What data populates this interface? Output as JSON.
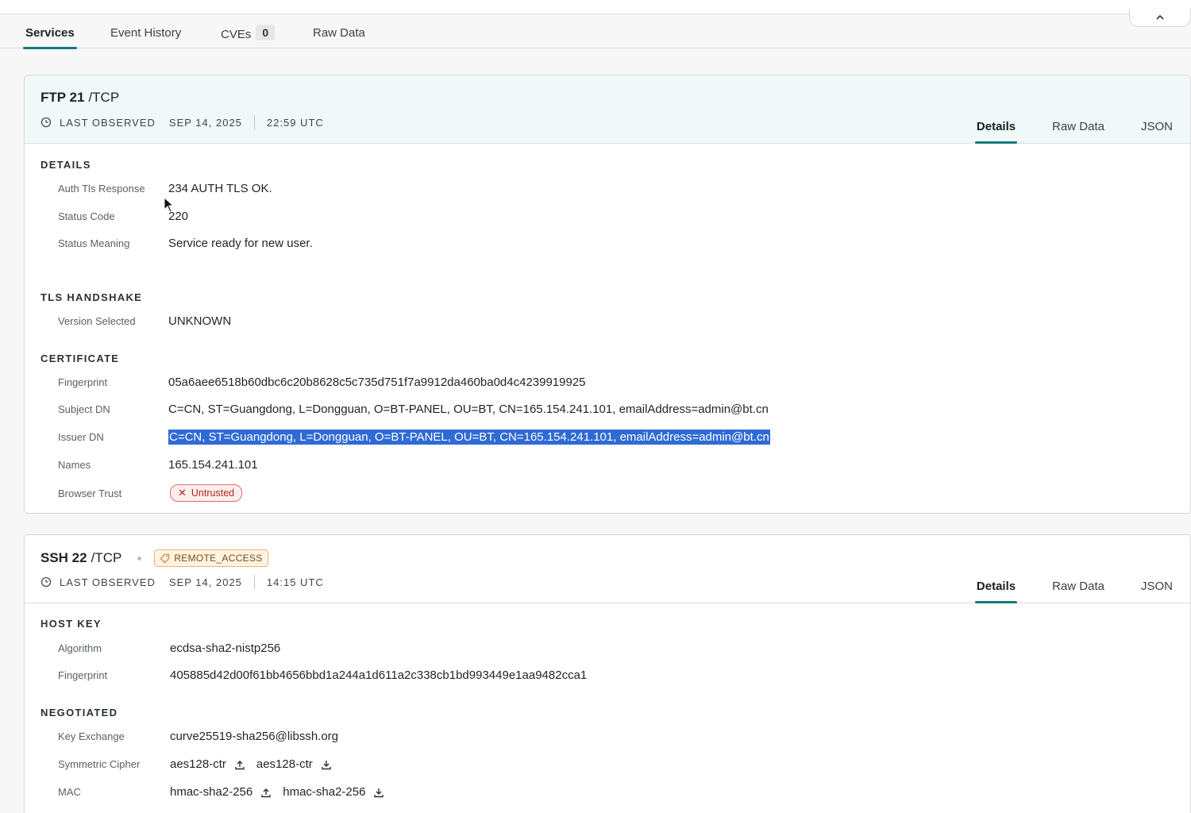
{
  "main_tabs": [
    {
      "label": "Services",
      "active": true
    },
    {
      "label": "Event History",
      "active": false
    },
    {
      "label": "CVEs",
      "count": "0",
      "active": false
    },
    {
      "label": "Raw Data",
      "active": false
    }
  ],
  "card_tabs": [
    "Details",
    "Raw Data",
    "JSON"
  ],
  "ftp": {
    "name": "FTP 21",
    "proto": "/TCP",
    "observed_label": "LAST OBSERVED",
    "observed_date": "SEP 14, 2025",
    "observed_time": "22:59 UTC",
    "details": {
      "title": "DETAILS",
      "rows": [
        {
          "label": "Auth Tls Response",
          "value": "234 AUTH TLS OK."
        },
        {
          "label": "Status Code",
          "value": "220"
        },
        {
          "label": "Status Meaning",
          "value": "Service ready for new user."
        }
      ]
    },
    "tls": {
      "title": "TLS HANDSHAKE",
      "rows": [
        {
          "label": "Version Selected",
          "value": "UNKNOWN"
        }
      ]
    },
    "certificate": {
      "title": "CERTIFICATE",
      "rows": [
        {
          "label": "Fingerprint",
          "value": "05a6aee6518b60dbc6c20b8628c5c735d751f7a9912da460ba0d4c4239919925"
        },
        {
          "label": "Subject DN",
          "value": "C=CN, ST=Guangdong, L=Dongguan, O=BT-PANEL, OU=BT, CN=165.154.241.101, emailAddress=admin@bt.cn"
        },
        {
          "label": "Issuer DN",
          "value": "C=CN, ST=Guangdong, L=Dongguan, O=BT-PANEL, OU=BT, CN=165.154.241.101, emailAddress=admin@bt.cn"
        },
        {
          "label": "Names",
          "value": "165.154.241.101"
        },
        {
          "label": "Browser Trust",
          "value": "Untrusted"
        }
      ]
    }
  },
  "ssh": {
    "name": "SSH 22",
    "proto": "/TCP",
    "tag": "REMOTE_ACCESS",
    "observed_label": "LAST OBSERVED",
    "observed_date": "SEP 14, 2025",
    "observed_time": "14:15 UTC",
    "host_key": {
      "title": "HOST KEY",
      "rows": [
        {
          "label": "Algorithm",
          "value": "ecdsa-sha2-nistp256"
        },
        {
          "label": "Fingerprint",
          "value": "405885d42d00f61bb4656bbd1a244a1d611a2c338cb1bd993449e1aa9482cca1"
        }
      ]
    },
    "negotiated": {
      "title": "NEGOTIATED",
      "kex_label": "Key Exchange",
      "kex_value": "curve25519-sha256@libssh.org",
      "cipher_label": "Symmetric Cipher",
      "cipher_out": "aes128-ctr",
      "cipher_in": "aes128-ctr",
      "mac_label": "MAC",
      "mac_out": "hmac-sha2-256",
      "mac_in": "hmac-sha2-256"
    }
  },
  "colors": {
    "accent": "#17797a",
    "selection": "#2f6bd5",
    "danger": "#b3261e",
    "tag": "#f1b26a"
  }
}
